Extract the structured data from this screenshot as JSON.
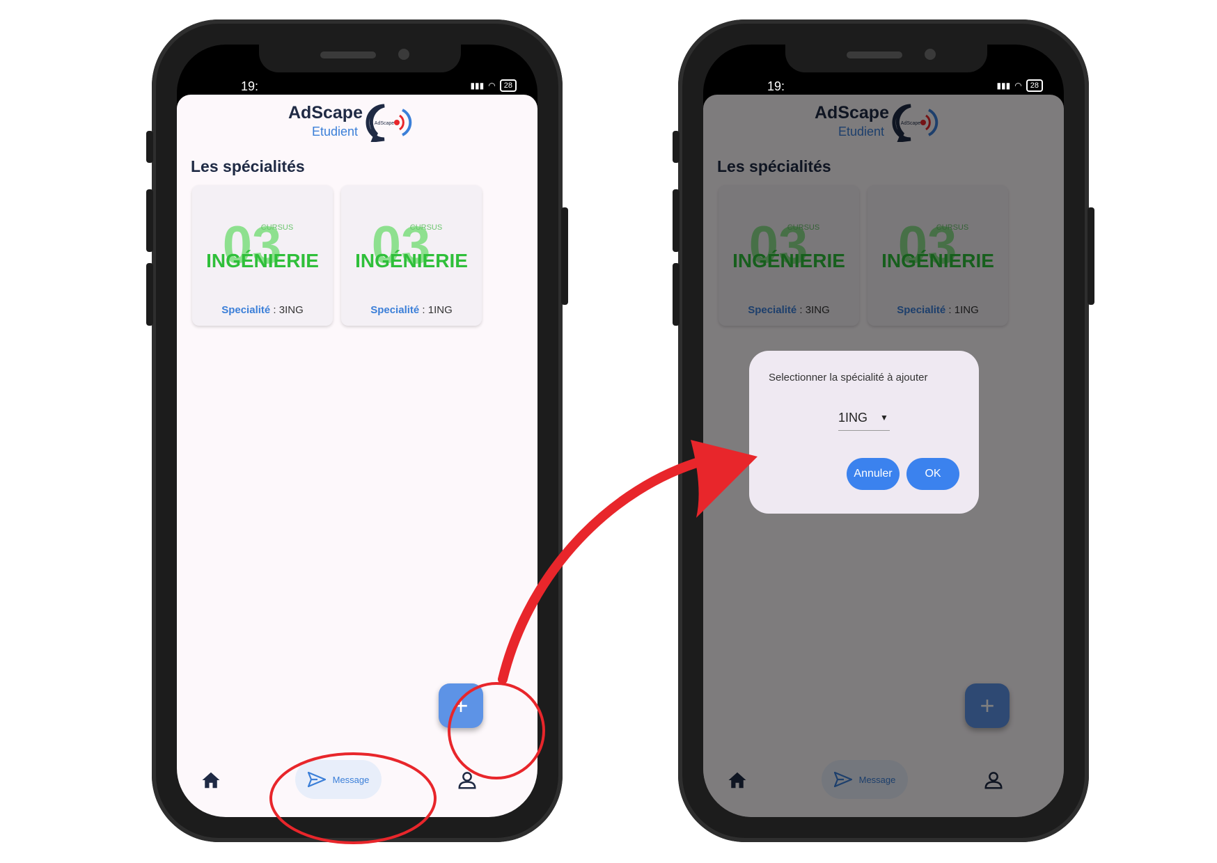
{
  "status": {
    "time_left": "19:",
    "time_right": "19:",
    "battery": "28"
  },
  "app": {
    "name": "AdScape",
    "role": "Etudient",
    "logo_text": "AdScape"
  },
  "section_title": "Les spécialités",
  "cards": [
    {
      "key": "Specialité",
      "sep": " : ",
      "value": "3ING",
      "art_top": "CURSUS",
      "art_big": "03",
      "art_bottom": "INGÉNIERIE"
    },
    {
      "key": "Specialité",
      "sep": " : ",
      "value": "1ING",
      "art_top": "CURSUS",
      "art_big": "03",
      "art_bottom": "INGÉNIERIE"
    }
  ],
  "fab": {
    "label": "+"
  },
  "nav": {
    "message": "Message"
  },
  "dialog": {
    "prompt": "Selectionner la spécialité à ajouter",
    "selected": "1ING",
    "cancel": "Annuler",
    "ok": "OK"
  },
  "colors": {
    "accent": "#3b82ee",
    "text_dark": "#1f2a44",
    "annotation": "#e8262b"
  }
}
